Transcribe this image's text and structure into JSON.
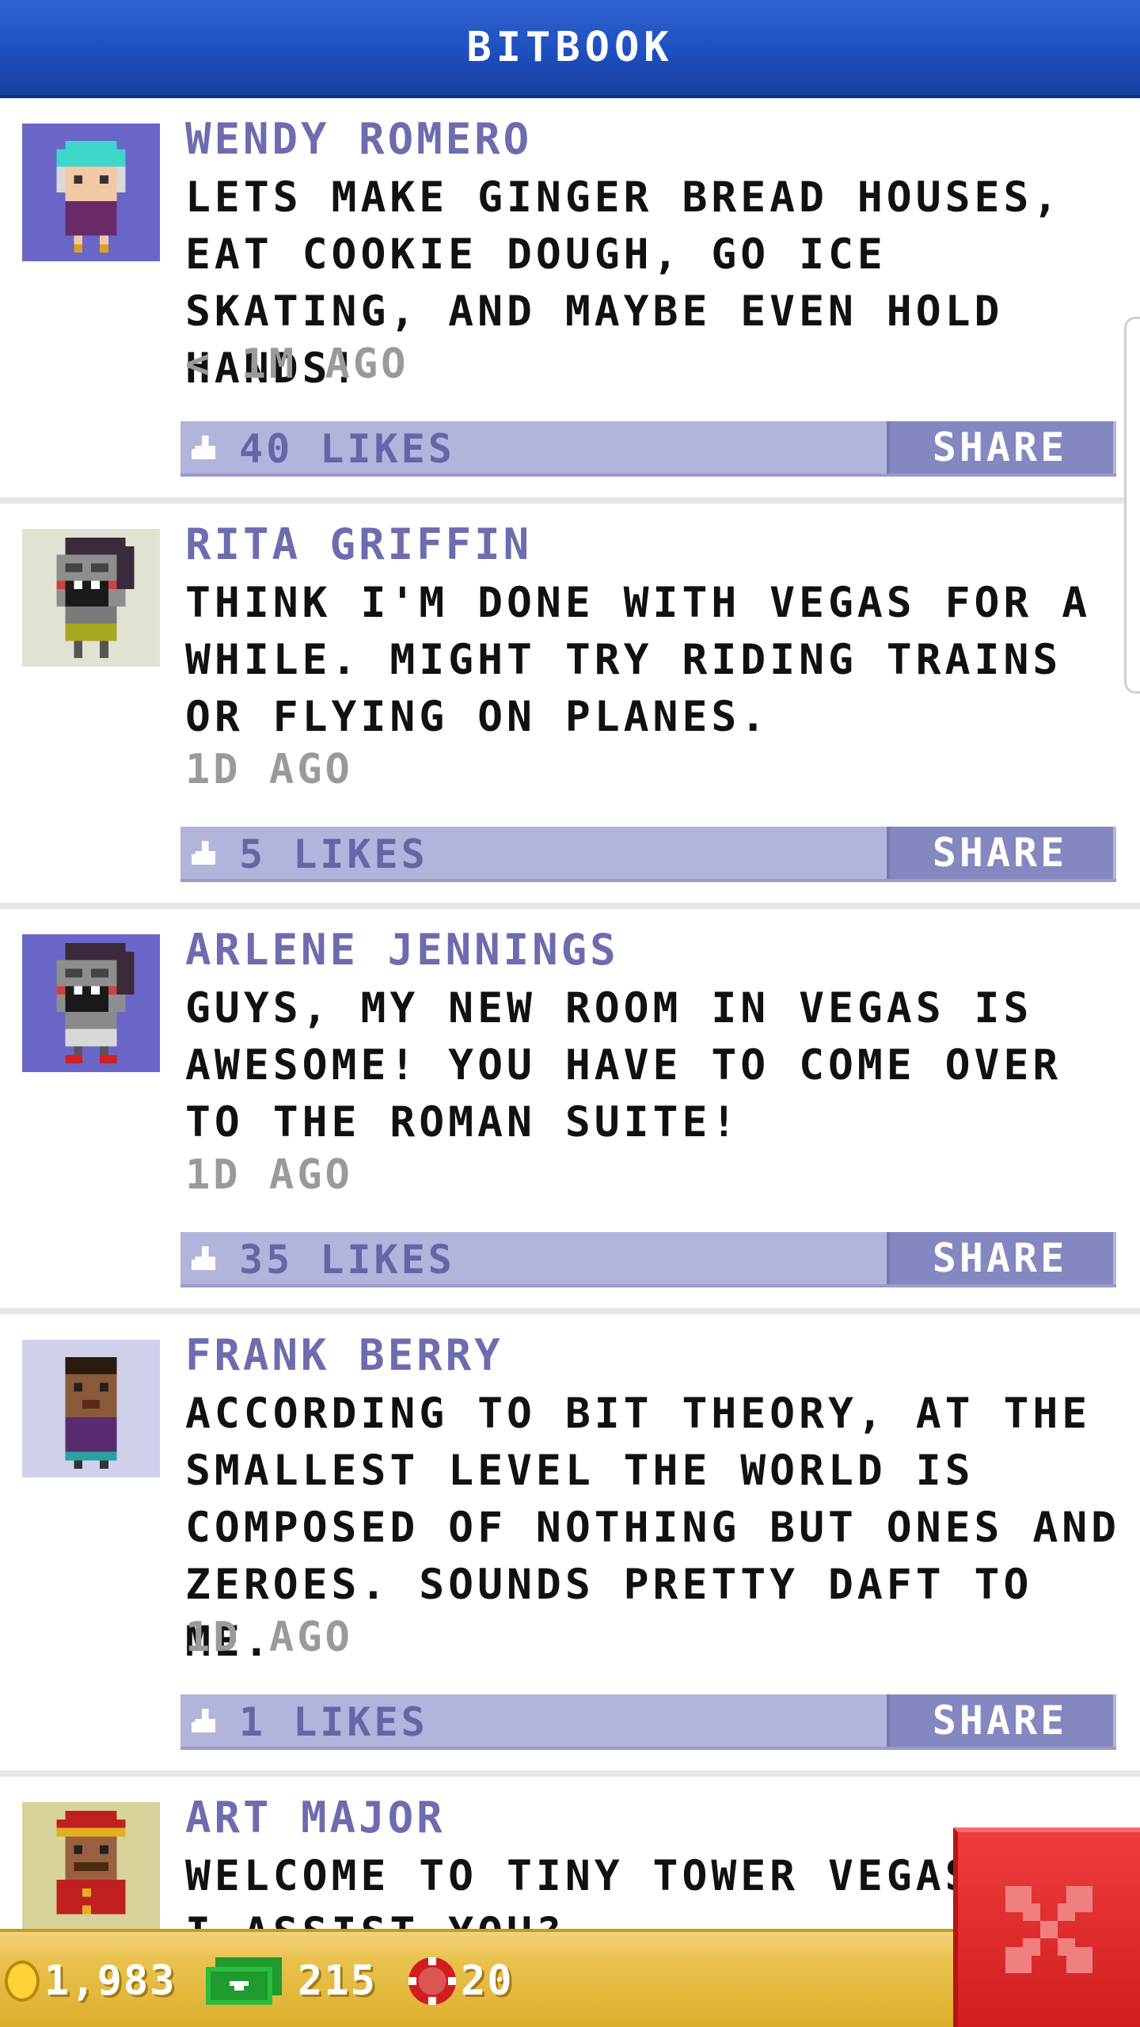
{
  "header": {
    "title": "BITBOOK"
  },
  "posts": [
    {
      "author": "WENDY ROMERO",
      "message": "LETS MAKE GINGER BREAD HOUSES, EAT COOKIE DOUGH, GO ICE SKATING, AND MAYBE EVEN HOLD HANDS!",
      "time": "< 1M AGO",
      "likes": "40 LIKES",
      "share_label": "SHARE",
      "avatar_bg": "#6a66c8"
    },
    {
      "author": "RITA GRIFFIN",
      "message": "THINK I'M DONE WITH VEGAS FOR A WHILE. MIGHT TRY RIDING TRAINS OR FLYING ON PLANES.",
      "time": "1D AGO",
      "likes": "5 LIKES",
      "share_label": "SHARE",
      "avatar_bg": "#e2e2d4"
    },
    {
      "author": "ARLENE JENNINGS",
      "message": "GUYS, MY NEW ROOM IN VEGAS IS AWESOME! YOU HAVE TO COME OVER TO THE ROMAN SUITE!",
      "time": "1D AGO",
      "likes": "35 LIKES",
      "share_label": "SHARE",
      "avatar_bg": "#6a66c8"
    },
    {
      "author": "FRANK BERRY",
      "message": "ACCORDING TO BIT THEORY, AT THE SMALLEST LEVEL THE WORLD IS COMPOSED OF NOTHING BUT ONES AND ZEROES. SOUNDS PRETTY DAFT TO ME.",
      "time": "1D AGO",
      "likes": "1 LIKES",
      "share_label": "SHARE",
      "avatar_bg": "#cfd0ea"
    },
    {
      "author": "ART MAJOR",
      "message": "WELCOME TO TINY TOWER VEGAS! MAY I ASSIST YOU?",
      "avatar_bg": "#d8d39a"
    }
  ],
  "resources": {
    "coins": "1,983",
    "bux": "215",
    "chips": "20"
  },
  "colors": {
    "header": "#1e4fbf",
    "author": "#6c6cae",
    "likebar": "#b3b4dc",
    "share": "#8587c0",
    "bottombar": "#e9c24e",
    "close": "#e02828"
  }
}
